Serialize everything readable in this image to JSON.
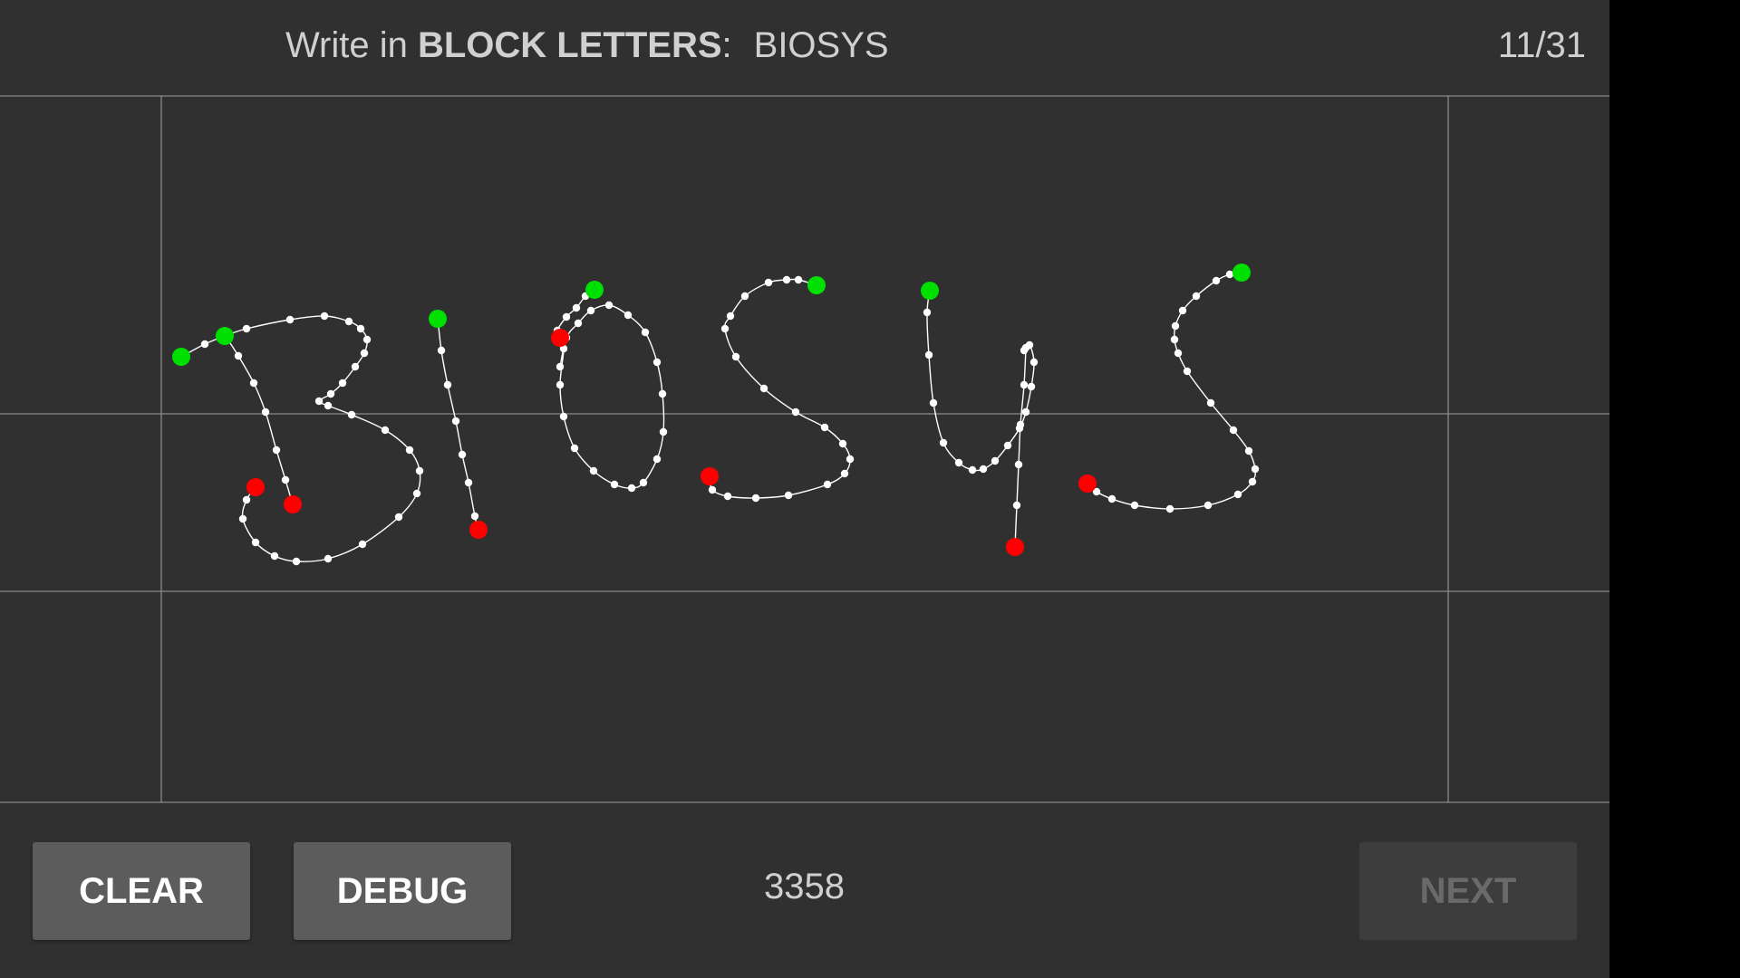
{
  "header": {
    "instruction_prefix": "Write in ",
    "instruction_emphasis": "BLOCK LETTERS",
    "instruction_suffix": ":",
    "target_word": "BIOSYS",
    "progress": "11/31"
  },
  "footer": {
    "clear_label": "CLEAR",
    "debug_label": "DEBUG",
    "counter": "3358",
    "next_label": "NEXT",
    "next_enabled": false
  },
  "colors": {
    "background": "#303030",
    "guide_lines": "#8a8a8a",
    "ink": "#ffffff",
    "stroke_start": "#00e000",
    "stroke_end": "#ff0000"
  }
}
